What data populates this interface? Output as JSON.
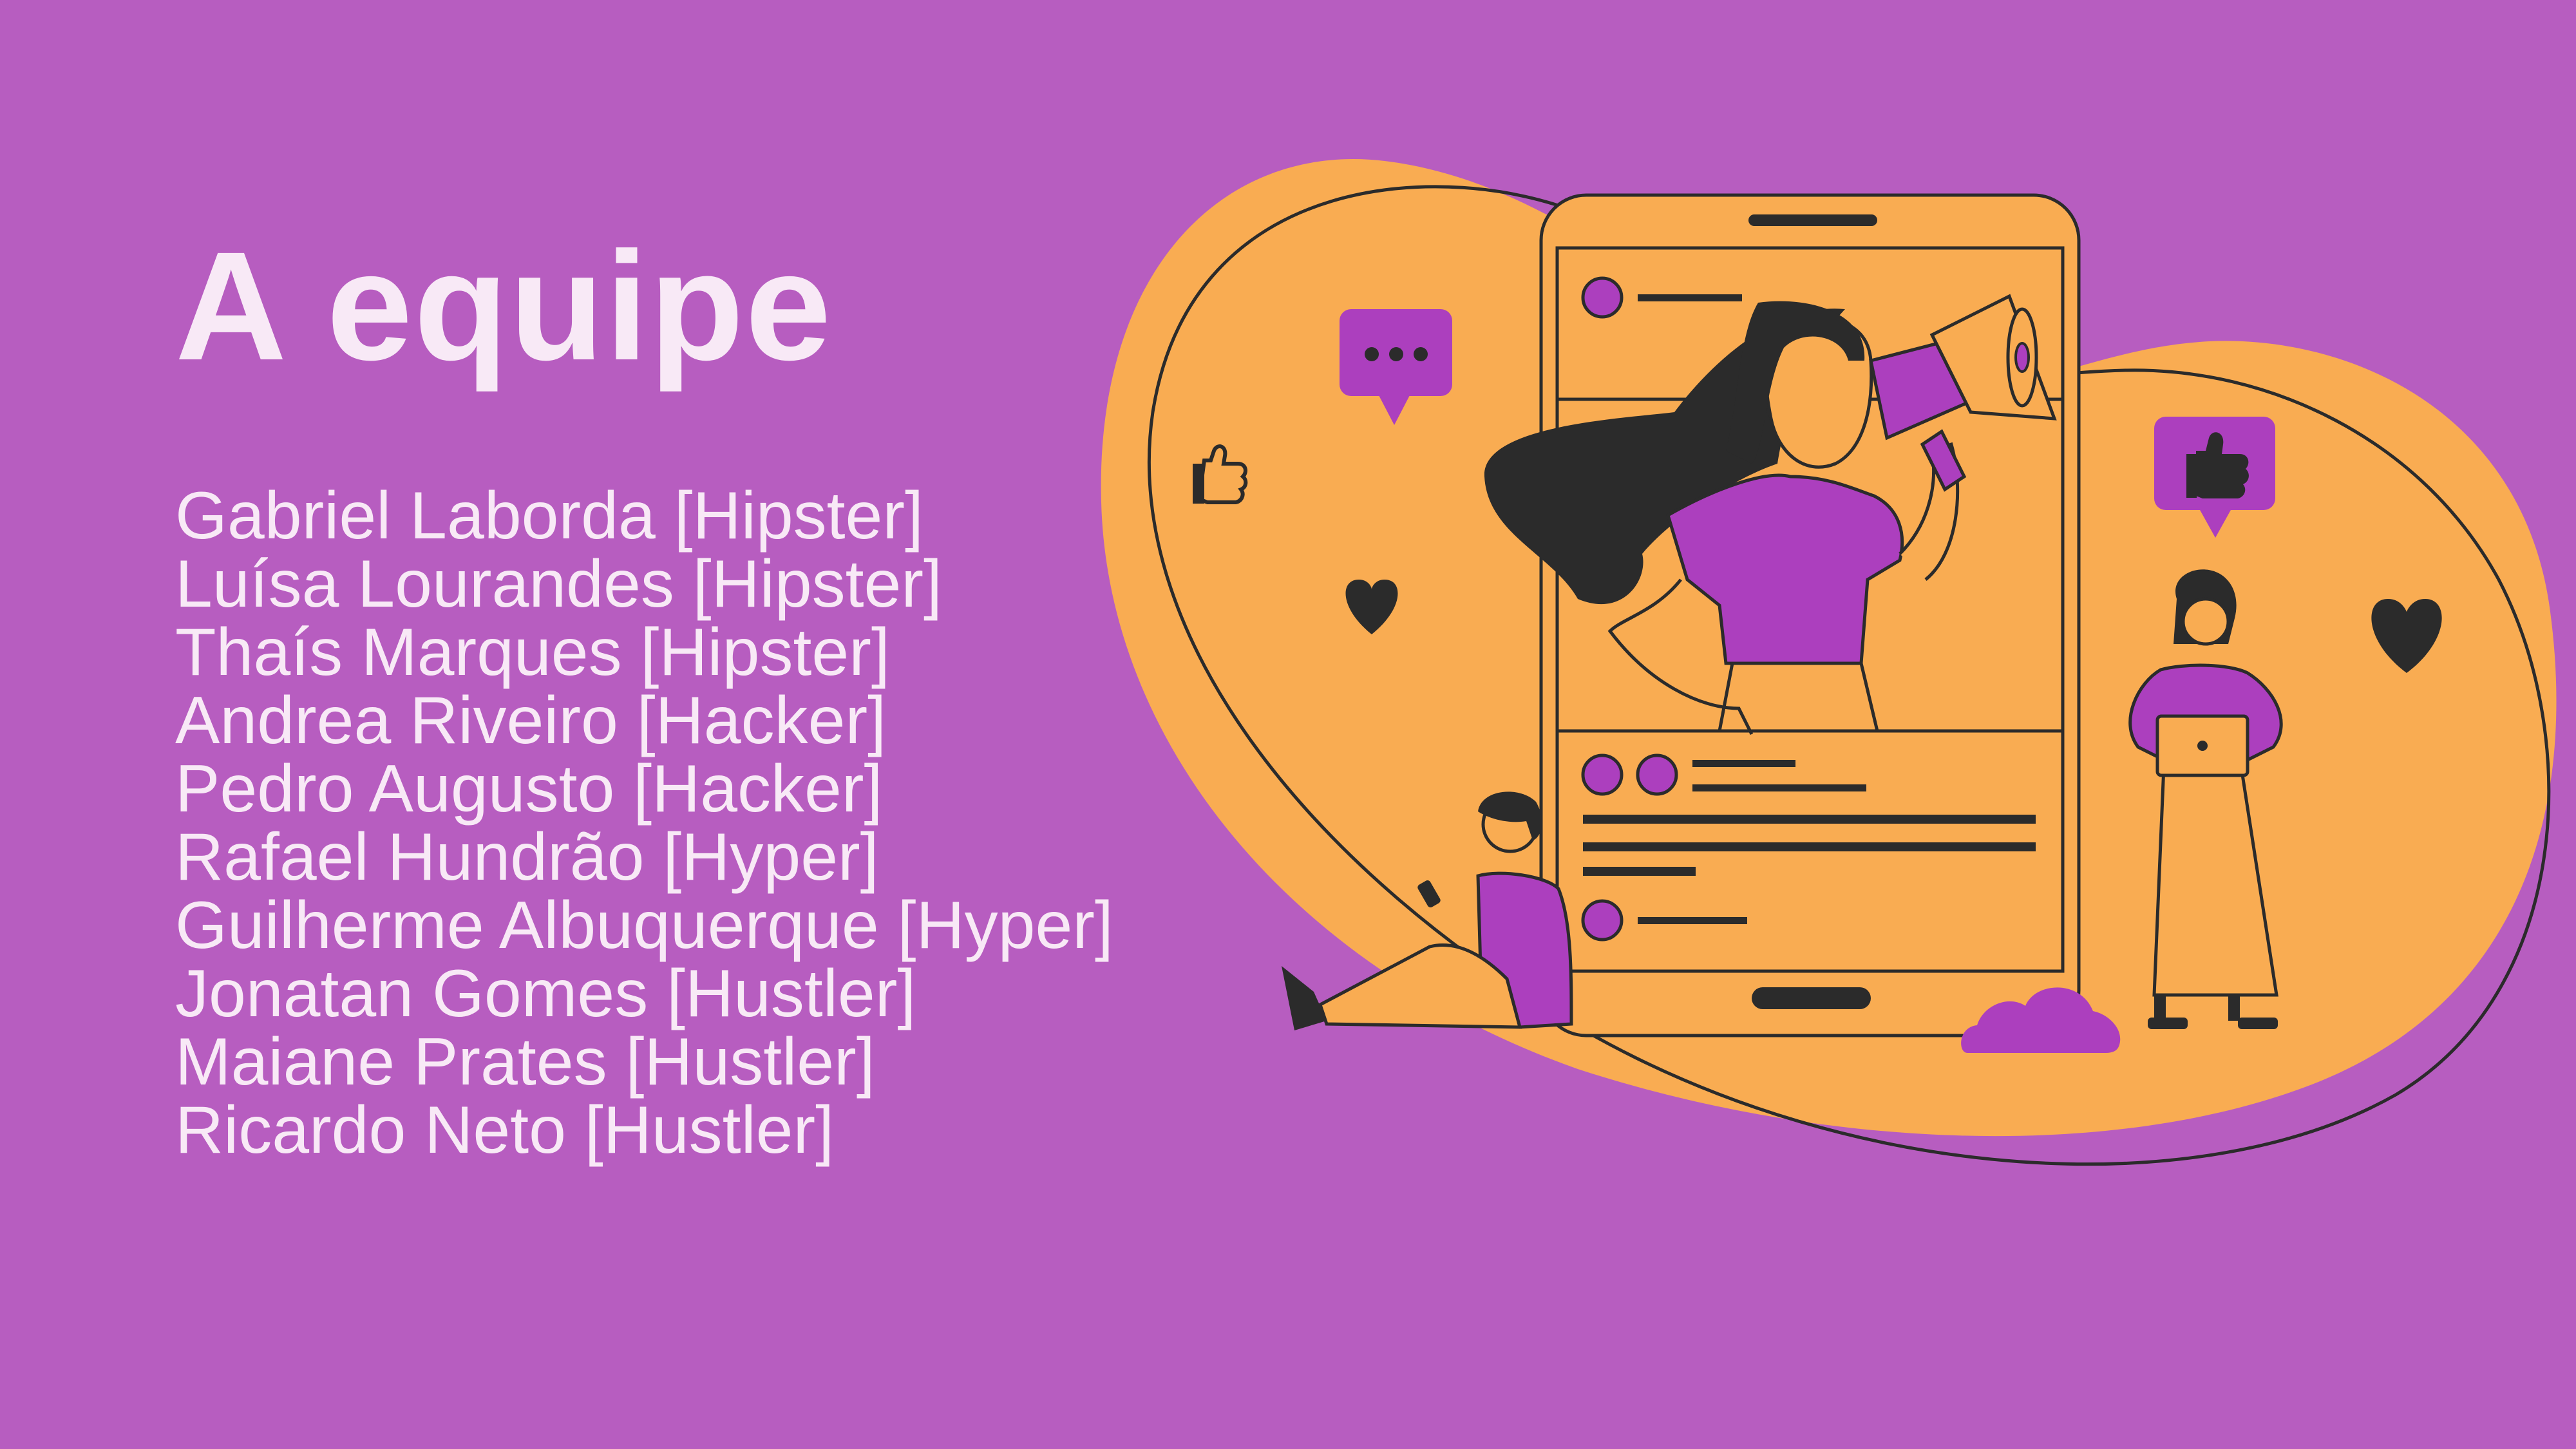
{
  "slide": {
    "title": "A equipe",
    "members": [
      {
        "text": "Gabriel Laborda [Hipster]"
      },
      {
        "text": "Luísa Lourandes [Hipster]"
      },
      {
        "text": "Thaís Marques [Hipster]"
      },
      {
        "text": "Andrea Riveiro [Hacker]"
      },
      {
        "text": "Pedro Augusto [Hacker]"
      },
      {
        "text": "Rafael Hundrão [Hyper]"
      },
      {
        "text": "Guilherme Albuquerque [Hyper]"
      },
      {
        "text": "Jonatan Gomes [Hustler]"
      },
      {
        "text": "Maiane Prates [Hustler]"
      },
      {
        "text": "Ricardo Neto [Hustler]"
      }
    ]
  },
  "colors": {
    "background": "#B75DC0",
    "accent_orange": "#F9AC52",
    "accent_purple": "#AC3FBE",
    "dark": "#2B2B2B",
    "text": "#F8E9F6"
  },
  "illustration": {
    "icons": [
      "chat-bubble-icon",
      "thumbs-up-icon",
      "heart-icon",
      "cloud-icon",
      "megaphone-icon",
      "smartphone-icon",
      "laptop-icon"
    ]
  }
}
